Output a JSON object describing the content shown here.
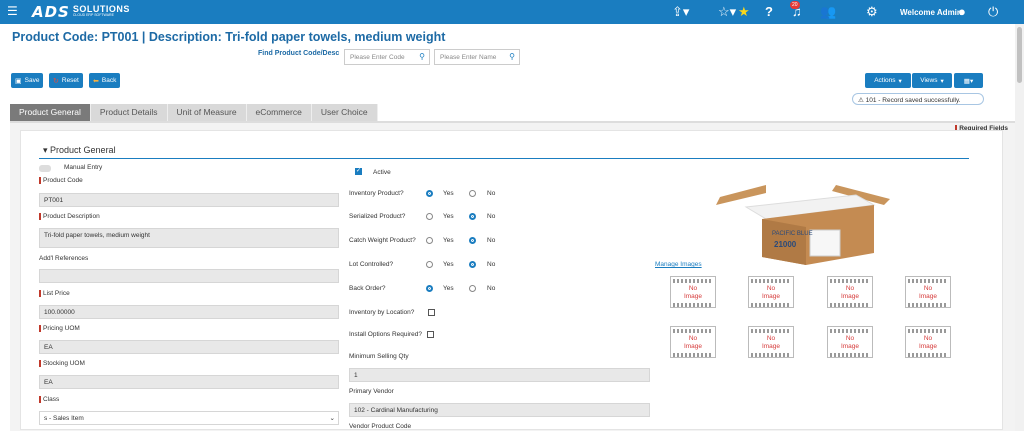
{
  "app": {
    "logo_main": "ADS",
    "logo_sub": "SOLUTIONS",
    "logo_tag": "CLOUD ERP SOFTWARE",
    "welcome": "Welcome Admin",
    "notification_count": "20"
  },
  "page": {
    "title": "Product Code:  PT001 | Description: Tri-fold paper towels, medium weight"
  },
  "find": {
    "label": "Find Product Code/Desc",
    "code_placeholder": "Please Enter Code",
    "name_placeholder": "Please Enter Name"
  },
  "toolbar": {
    "save": "Save",
    "reset": "Reset",
    "back": "Back",
    "actions": "Actions",
    "views": "Views"
  },
  "message": "101 - Record saved successfully.",
  "tabs": [
    "Product General",
    "Product Details",
    "Unit of Measure",
    "eCommerce",
    "User Choice"
  ],
  "required_fields": "Required Fields",
  "section": {
    "title": "Product General"
  },
  "left": {
    "manual_entry": "Manual Entry",
    "product_code_label": "Product Code",
    "product_code": "PT001",
    "description_label": "Product Description",
    "description": "Tri-fold paper towels, medium weight",
    "addl_ref_label": "Add'l References",
    "addl_ref": "",
    "list_price_label": "List Price",
    "list_price": "100.00000",
    "pricing_uom_label": "Pricing UOM",
    "pricing_uom": "EA",
    "stocking_uom_label": "Stocking UOM",
    "stocking_uom": "EA",
    "class_label": "Class",
    "class_value": "s - Sales Item"
  },
  "mid": {
    "active": "Active",
    "inventory_product": "Inventory Product?",
    "serialized_product": "Serialized Product?",
    "catch_weight": "Catch Weight Product?",
    "lot_controlled": "Lot Controlled?",
    "back_order": "Back Order?",
    "yes": "Yes",
    "no": "No",
    "inventory_by_location": "Inventory by Location?",
    "install_options": "Install Options Required?",
    "min_selling_qty_label": "Minimum Selling Qty",
    "min_selling_qty": "1",
    "primary_vendor_label": "Primary Vendor",
    "primary_vendor": "102 - Cardinal Manufacturing",
    "vendor_product_code_label": "Vendor Product Code"
  },
  "images": {
    "no_image_line1": "No",
    "no_image_line2": "Image",
    "manage": "Manage Images",
    "box_brand": "PACIFIC BLUE",
    "box_num": "21000"
  },
  "colors": {
    "brand": "#1a7dc0",
    "required": "#c0392b"
  }
}
